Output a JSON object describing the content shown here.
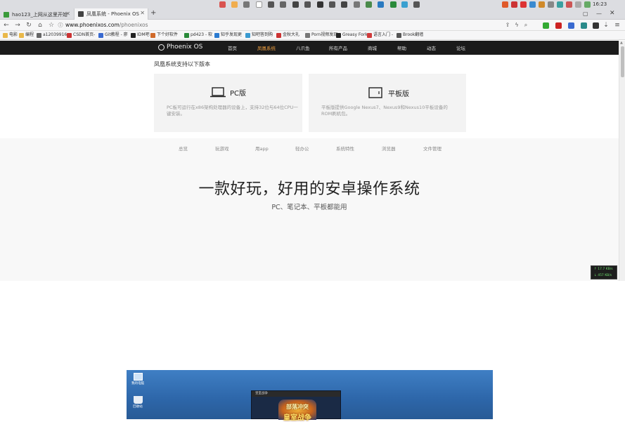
{
  "browser": {
    "tabs": [
      {
        "title": "hao123_上网从这里开始",
        "active": false
      },
      {
        "title": "凤凰系统 - Phoenix OS",
        "active": true
      }
    ],
    "new_tab": "+",
    "clock": "16:23",
    "url": {
      "host": "www.phoenixos.com",
      "path": "/phoenixos"
    },
    "bookmarks": [
      "电影",
      "编程",
      "a12039916",
      "CSDN首页-",
      "Git教程 - 廖",
      "IDM吧",
      "下个好软件",
      "pd423 - 软",
      "知乎发现更",
      "知吧答到购",
      "金秋大礼",
      "Porn视频发现",
      "Greasy Fork",
      "语言入门 -",
      "Brook翻墙"
    ]
  },
  "site": {
    "logo_text": "Phoenix OS",
    "nav": [
      "首页",
      "凤凰系统",
      "八爪鱼",
      "所有产品",
      "商城",
      "帮助",
      "动态",
      "论坛"
    ],
    "active_nav": "凤凰系统",
    "supports_title": "凤凰系统支持以下版本",
    "cards": [
      {
        "title": "PC版",
        "icon": "laptop-icon",
        "desc": "PC板可运行在x86架构处理器的设备上，支持32位与64位CPU一键安装。"
      },
      {
        "title": "平板版",
        "icon": "tablet-icon",
        "desc": "平板版提供Google Nexus7、Nexus9和Nexus10平板设备的ROM刷机包。"
      }
    ],
    "subnav": [
      "总览",
      "玩游戏",
      "用app",
      "轻办公",
      "系统特性",
      "浏览器",
      "文件管理"
    ],
    "headline": "一款好玩，好用的安卓操作系统",
    "subline": "PC、笔记本、平板都能用",
    "demo": {
      "desktop_icons": [
        "我的电脑",
        "回收站"
      ],
      "app_title": "皇室战争",
      "art_line1": "部落冲突",
      "art_line2": "皇室战争"
    }
  },
  "netspeed": {
    "up": "↑ 17.7 KB/s",
    "down": "↓ 457 KB/s"
  },
  "colors": {
    "nav_bg": "#1b1b1b",
    "nav_active": "#f0a040",
    "card_bg": "#f3f3f3",
    "demo_blue": "#3f7fc4"
  }
}
